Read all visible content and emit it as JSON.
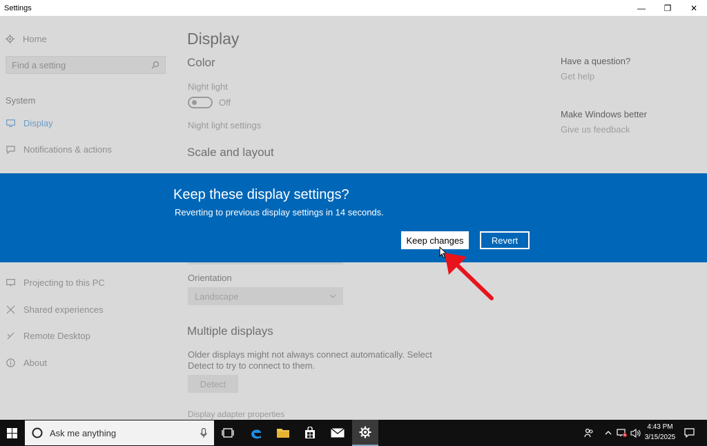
{
  "window": {
    "title": "Settings",
    "minimize_glyph": "—",
    "restore_glyph": "❐",
    "close_glyph": "✕"
  },
  "sidebar": {
    "home_label": "Home",
    "search_placeholder": "Find a setting",
    "section_label": "System",
    "items": [
      {
        "label": "Display",
        "icon": "monitor-icon",
        "active": true
      },
      {
        "label": "Notifications & actions",
        "icon": "notification-icon"
      },
      {
        "label": "Projecting to this PC",
        "icon": "projector-icon"
      },
      {
        "label": "Shared experiences",
        "icon": "share-icon"
      },
      {
        "label": "Remote Desktop",
        "icon": "remote-icon"
      },
      {
        "label": "About",
        "icon": "info-icon"
      }
    ]
  },
  "main": {
    "page_title": "Display",
    "color_heading": "Color",
    "night_light_label": "Night light",
    "night_light_state": "Off",
    "night_light_settings_link": "Night light settings",
    "scale_heading": "Scale and layout",
    "orientation_label": "Orientation",
    "orientation_value": "Landscape",
    "multiple_heading": "Multiple displays",
    "multiple_desc_line1": "Older displays might not always connect automatically. Select",
    "multiple_desc_line2": "Detect to try to connect to them.",
    "detect_button": "Detect",
    "adapter_link": "Display adapter properties"
  },
  "aside": {
    "question_heading": "Have a question?",
    "get_help": "Get help",
    "better_heading": "Make Windows better",
    "feedback": "Give us feedback"
  },
  "dialog": {
    "title": "Keep these display settings?",
    "message": "Reverting to previous display settings in 14 seconds.",
    "keep_button": "Keep changes",
    "revert_button": "Revert",
    "background_color": "#0067b8"
  },
  "taskbar": {
    "search_placeholder": "Ask me anything",
    "time": "4:43 PM",
    "date": "3/15/2025"
  },
  "annotation": {
    "arrow_color": "#e8141c"
  }
}
